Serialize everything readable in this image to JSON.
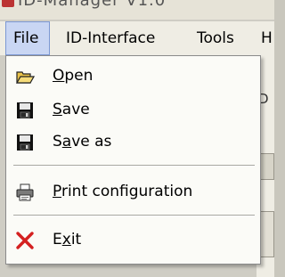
{
  "window": {
    "title": "ID-Manager V1.0"
  },
  "menubar": {
    "items": [
      {
        "label": "File",
        "active": true
      },
      {
        "label": "ID-Interface"
      },
      {
        "label": "Tools"
      },
      {
        "label": "H"
      }
    ]
  },
  "background": {
    "fragment": "D"
  },
  "file_menu": {
    "items": [
      {
        "label": "Open",
        "icon": "open-folder-icon",
        "mnemonic": "O"
      },
      {
        "label": "Save",
        "icon": "floppy-disk-icon",
        "mnemonic": "S"
      },
      {
        "label": "Save as",
        "icon": "floppy-disk-icon",
        "mnemonic": "a"
      },
      {
        "label": "Print configuration",
        "icon": "printer-icon",
        "mnemonic": "P"
      },
      {
        "label": "Exit",
        "icon": "exit-x-icon",
        "mnemonic": "x"
      }
    ]
  },
  "colors": {
    "menu_highlight": "#c9d6f3",
    "menubar_bg": "#efede4",
    "exit_icon": "#d42020"
  }
}
